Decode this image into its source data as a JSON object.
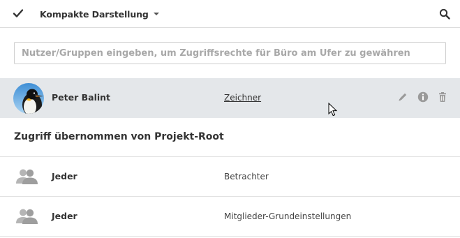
{
  "toolbar": {
    "check_icon": "checkmark-icon",
    "view_label": "Kompakte Darstellung",
    "dropdown_icon": "caret-down-icon",
    "search_icon": "search-icon"
  },
  "share_input": {
    "placeholder": "Nutzer/Gruppen eingeben, um Zugriffsrechte für Büro am Ufer zu gewähren",
    "value": ""
  },
  "members": [
    {
      "name": "Peter Balint",
      "role": "Zeichner",
      "avatar_icon": "penguin-avatar",
      "actions": [
        "pencil-icon",
        "info-icon",
        "trash-icon"
      ]
    }
  ],
  "inherited": {
    "heading": "Zugriff übernommen von Projekt-Root",
    "rows": [
      {
        "name": "Jeder",
        "role": "Betrachter",
        "icon": "group-icon"
      },
      {
        "name": "Jeder",
        "role": "Mitglieder-Grundeinstellungen",
        "icon": "group-icon"
      }
    ]
  },
  "colors": {
    "highlight_row": "#e4e7ea",
    "icon_gray": "#9a9a9a",
    "text": "#333333"
  }
}
